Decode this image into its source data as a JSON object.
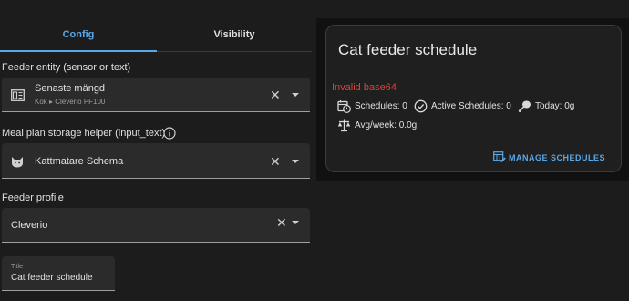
{
  "tabs": [
    {
      "label": "Config"
    },
    {
      "label": "Visibility"
    }
  ],
  "feeder_entity": {
    "label": "Feeder entity (sensor or text)",
    "value": "Senaste mängd",
    "subtitle": "Kök ▸ Cleverio PF100"
  },
  "meal_plan": {
    "label": "Meal plan storage helper (input_text)",
    "value": "Kattmatare Schema"
  },
  "feeder_profile": {
    "label": "Feeder profile",
    "value": "Cleverio"
  },
  "title_field": {
    "label": "Title",
    "value": "Cat feeder schedule"
  },
  "card": {
    "title": "Cat feeder schedule",
    "error": "Invalid base64",
    "schedules": "Schedules: 0",
    "active_schedules": "Active Schedules: 0",
    "today": "Today: 0g",
    "avg_week": "Avg/week: 0.0g",
    "manage_label": "MANAGE SCHEDULES"
  },
  "colors": {
    "accent": "#5aa8e8",
    "error": "#db4437"
  }
}
